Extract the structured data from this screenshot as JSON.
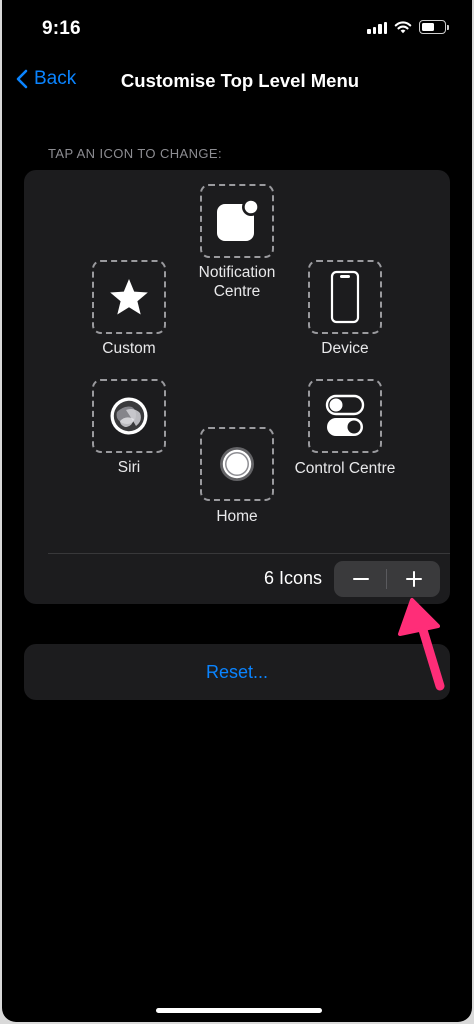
{
  "status_bar": {
    "time": "9:16"
  },
  "nav": {
    "back_label": "Back",
    "title": "Customise Top Level Menu"
  },
  "section_header": "TAP AN ICON TO CHANGE:",
  "slots": {
    "notification": {
      "label": "Notification Centre",
      "icon": "notification-centre-icon"
    },
    "custom": {
      "label": "Custom",
      "icon": "star-icon"
    },
    "device": {
      "label": "Device",
      "icon": "device-icon"
    },
    "siri": {
      "label": "Siri",
      "icon": "siri-icon"
    },
    "home": {
      "label": "Home",
      "icon": "home-icon"
    },
    "control": {
      "label": "Control Centre",
      "icon": "control-centre-icon"
    }
  },
  "icon_count": {
    "label": "6 Icons",
    "value": 6
  },
  "reset": {
    "label": "Reset..."
  },
  "colors": {
    "accent": "#0a84ff",
    "annotation_arrow": "#ff2d78",
    "card": "#1c1c1e",
    "background": "#000000"
  }
}
